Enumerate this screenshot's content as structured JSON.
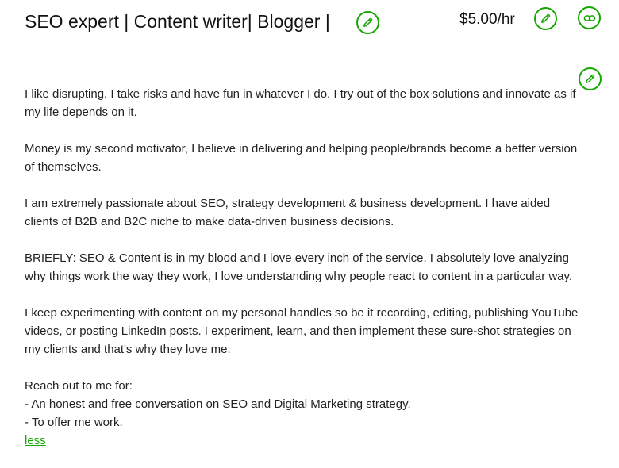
{
  "header": {
    "title": "SEO expert | Content writer| Blogger |",
    "rate": "$5.00/hr"
  },
  "icons": {
    "edit": "pencil-icon",
    "link": "link-icon",
    "accent_color": "#14a800"
  },
  "description": {
    "paragraphs": [
      "I like disrupting. I take risks and have fun in whatever I do. I try out of the box solutions and innovate as if my life depends on it.",
      "Money is my second motivator, I believe in delivering and helping people/brands become a better version of themselves.",
      "I am extremely passionate about SEO, strategy development & business development. I have aided clients of B2B and B2C niche to make data-driven business decisions.",
      "BRIEFLY: SEO & Content is in my blood and I love every inch of the service. I absolutely love analyzing why things work the way they work, I love understanding why people react to content in a particular way.",
      "I keep experimenting with content on my personal handles so be it recording, editing, publishing YouTube videos, or posting LinkedIn posts. I experiment, learn, and then implement these sure-shot strategies on my clients and that's why they love me."
    ],
    "reach_out_heading": "Reach out to me for:",
    "reach_out_items": [
      "- An honest and free conversation on SEO and Digital Marketing strategy.",
      "- To offer me work."
    ],
    "less_label": "less"
  }
}
